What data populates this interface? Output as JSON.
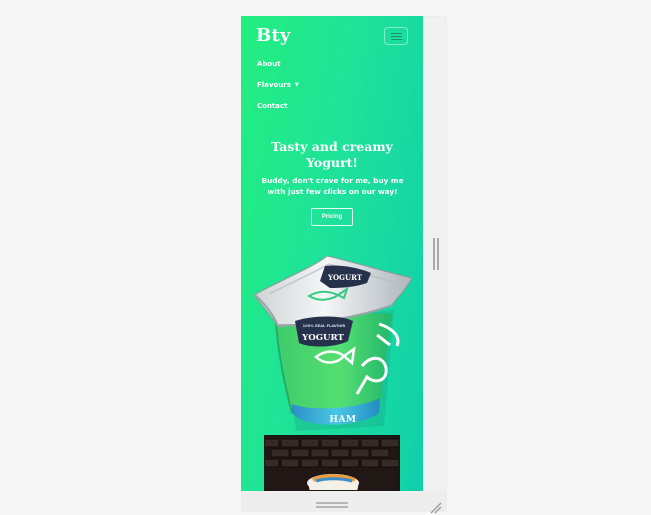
{
  "header": {
    "brand": "Bty",
    "menu_icon": "hamburger-menu-icon"
  },
  "nav": {
    "items": [
      {
        "label": "About"
      },
      {
        "label": "Flavours",
        "icon": "dropdown-caret-icon"
      },
      {
        "label": "Contact"
      }
    ]
  },
  "hero": {
    "title": "Tasty and creamy Yogurt!",
    "copy": "Buddy, don't crave for me, buy me with just few clicks on our way!",
    "button_label": "Pricing"
  },
  "product": {
    "lid_label": "YOGURT",
    "cup_label": "YOGURT",
    "flavour": "HAM",
    "tagline": "100% REAL FLAVOUR"
  },
  "controls": {
    "scrollbar_icon": "vertical-scrollbar-icon",
    "drag_icon": "drag-handle-icon",
    "resize_icon": "resize-corner-icon"
  },
  "colors": {
    "gradient_start": "#22ee7e",
    "gradient_end": "#10cfaa",
    "accent_dark": "#26314b",
    "cup_green": "#46d86f",
    "cup_blue": "#38b8d9"
  }
}
